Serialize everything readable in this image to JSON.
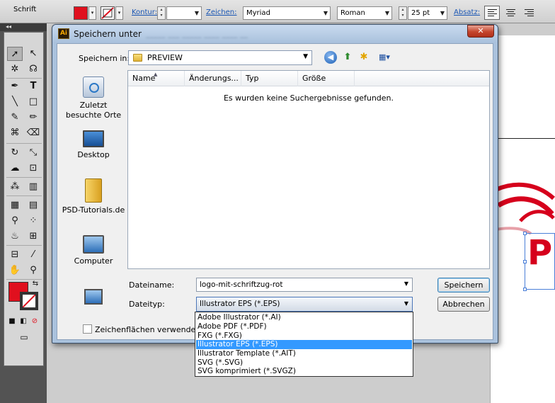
{
  "controlbar": {
    "label": "Schrift",
    "kontur_label": "Kontur:",
    "zeichen_label": "Zeichen:",
    "font_family": "Myriad",
    "font_style": "Roman",
    "font_size": "25 pt",
    "absatz_label": "Absatz:",
    "fill_color": "#e0101e"
  },
  "tools": {
    "collapse_label": "◂◂"
  },
  "dialog": {
    "title": "Speichern unter",
    "title_icon": "Ai",
    "title_ghost": "_____ ___ _____ ____ ____ __",
    "close": "✕",
    "lookin_label": "Speichern in:",
    "lookin_value": "PREVIEW",
    "places": [
      {
        "name": "recent-icon",
        "label": "Zuletzt besuchte Orte"
      },
      {
        "name": "desktop-icon",
        "label": "Desktop"
      },
      {
        "name": "user-folder-icon",
        "label": "PSD-Tutorials.de"
      },
      {
        "name": "computer-icon",
        "label": "Computer"
      },
      {
        "name": "network-icon",
        "label": ""
      }
    ],
    "columns": [
      "Name",
      "Änderungs...",
      "Typ",
      "Größe"
    ],
    "empty_message": "Es wurden keine Suchergebnisse gefunden.",
    "filename_label": "Dateiname:",
    "filename_value": "logo-mit-schriftzug-rot",
    "filetype_label": "Dateityp:",
    "filetype_value": "Illustrator EPS (*.EPS)",
    "save_button": "Speichern",
    "cancel_button": "Abbrechen",
    "artboards_label": "Zeichenflächen verwenden",
    "filetype_options": [
      "Adobe Illustrator (*.AI)",
      "Adobe PDF (*.PDF)",
      "FXG (*.FXG)",
      "Illustrator EPS (*.EPS)",
      "Illustrator Template (*.AIT)",
      "SVG (*.SVG)",
      "SVG komprimiert (*.SVGZ)"
    ],
    "selected_option_index": 3
  },
  "artwork": {
    "letter": "P",
    "brand_red": "#d6001c"
  }
}
